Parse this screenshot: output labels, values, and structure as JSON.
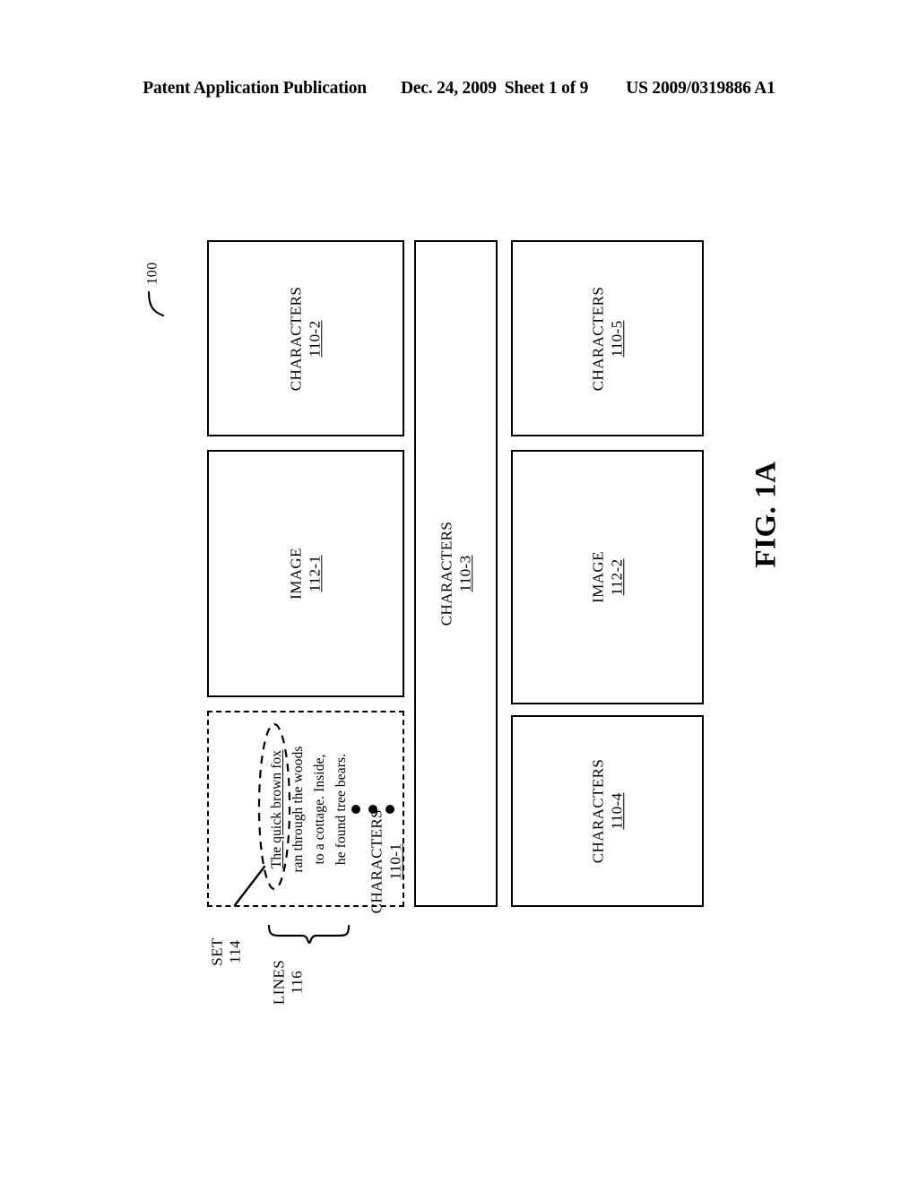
{
  "header": {
    "publication": "Patent Application Publication",
    "date": "Dec. 24, 2009",
    "sheet": "Sheet 1 of 9",
    "number": "US 2009/0319886 A1"
  },
  "figure": {
    "caption": "FIG. 1A",
    "page_reference": "100",
    "blocks": [
      {
        "id": "110-1",
        "label": "CHARACTERS",
        "ref": "110-1",
        "style": "dashed"
      },
      {
        "id": "112-1",
        "label": "IMAGE",
        "ref": "112-1",
        "style": "solid"
      },
      {
        "id": "110-2",
        "label": "CHARACTERS",
        "ref": "110-2",
        "style": "solid"
      },
      {
        "id": "110-3",
        "label": "CHARACTERS",
        "ref": "110-3",
        "style": "solid"
      },
      {
        "id": "110-4",
        "label": "CHARACTERS",
        "ref": "110-4",
        "style": "solid"
      },
      {
        "id": "112-2",
        "label": "IMAGE",
        "ref": "112-2",
        "style": "solid"
      },
      {
        "id": "110-5",
        "label": "CHARACTERS",
        "ref": "110-5",
        "style": "solid"
      }
    ],
    "text_lines": [
      "The quick brown fox",
      "ran through the woods",
      "to a cottage.  Inside,",
      "he found tree bears."
    ],
    "ellipsis": "•••",
    "callouts": [
      {
        "id": "set",
        "label": "SET",
        "ref": "114"
      },
      {
        "id": "lines",
        "label": "LINES",
        "ref": "116"
      }
    ]
  },
  "colors": {
    "ink": "#000000",
    "paper": "#ffffff"
  }
}
